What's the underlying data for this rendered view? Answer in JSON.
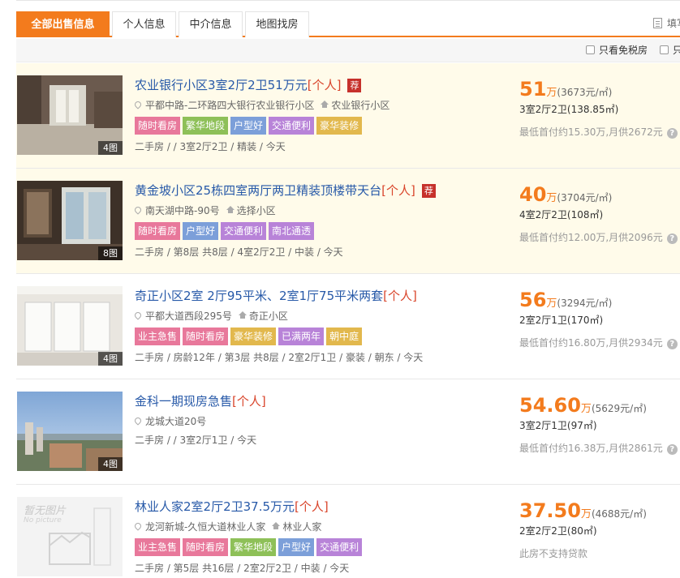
{
  "tabs": [
    {
      "label": "全部出售信息",
      "active": true
    },
    {
      "label": "个人信息",
      "active": false
    },
    {
      "label": "中介信息",
      "active": false
    },
    {
      "label": "地图找房",
      "active": false
    }
  ],
  "fill_form_label": "填写二",
  "filters": [
    "只看免税房",
    "只"
  ],
  "colors": {
    "accent": "#f37b1d",
    "link": "#2759a8",
    "personal": "#d9452b",
    "tag_pink": "#e8789b",
    "tag_green": "#8ec058",
    "tag_blue": "#7c9fd9",
    "tag_purple": "#b883d8",
    "tag_gold": "#e2b84d"
  },
  "listings": [
    {
      "title": "农业银行小区3室2厅2卫51万元",
      "personal": "[个人]",
      "recommended": "荐",
      "address": "平都中路-二环路四大银行农业银行小区",
      "community": "农业银行小区",
      "tags": [
        "随时看房",
        "繁华地段",
        "户型好",
        "交通便利",
        "豪华装修"
      ],
      "meta": "二手房 / / 3室2厅2卫 / 精装 / 今天",
      "price": "51",
      "price_unit": "万",
      "unit_price": "(3673元/㎡)",
      "layout": "3室2厅2卫(138.85㎡)",
      "loan": "最低首付约15.30万,月供2672元",
      "photo_count": "4图"
    },
    {
      "title": "黄金坡小区25栋四室两厅两卫精装顶楼带天台",
      "personal": "[个人]",
      "recommended": "荐",
      "address": "南天湖中路-90号",
      "community": "选择小区",
      "tags": [
        "随时看房",
        "户型好",
        "交通便利",
        "南北通透"
      ],
      "meta": "二手房 / 第8层 共8层 / 4室2厅2卫 / 中装 / 今天",
      "price": "40",
      "price_unit": "万",
      "unit_price": "(3704元/㎡)",
      "layout": "4室2厅2卫(108㎡)",
      "loan": "最低首付约12.00万,月供2096元",
      "photo_count": "8图"
    },
    {
      "title": "奇正小区2室 2厅95平米、2室1厅75平米两套",
      "personal": "[个人]",
      "recommended": "",
      "address": "平都大道西段295号",
      "community": "奇正小区",
      "tags": [
        "业主急售",
        "随时看房",
        "豪华装修",
        "已满两年",
        "朝中庭"
      ],
      "meta": "二手房 / 房龄12年 / 第3层 共8层 / 2室2厅1卫 / 豪装 / 朝东 / 今天",
      "price": "56",
      "price_unit": "万",
      "unit_price": "(3294元/㎡)",
      "layout": "2室2厅1卫(170㎡)",
      "loan": "最低首付约16.80万,月供2934元",
      "photo_count": "4图"
    },
    {
      "title": "金科一期现房急售",
      "personal": "[个人]",
      "recommended": "",
      "address": "龙城大道20号",
      "community": "",
      "tags": [],
      "meta": "二手房 / / 3室2厅1卫 / 今天",
      "price": "54.60",
      "price_unit": "万",
      "unit_price": "(5629元/㎡)",
      "layout": "3室2厅1卫(97㎡)",
      "loan": "最低首付约16.38万,月供2861元",
      "photo_count": "4图"
    },
    {
      "title": "林业人家2室2厅2卫37.5万元",
      "personal": "[个人]",
      "recommended": "",
      "address": "龙河新城-久恒大道林业人家",
      "community": "林业人家",
      "tags": [
        "业主急售",
        "随时看房",
        "繁华地段",
        "户型好",
        "交通便利"
      ],
      "meta": "二手房 / 第5层 共16层 / 2室2厅2卫 / 中装 / 今天",
      "price": "37.50",
      "price_unit": "万",
      "unit_price": "(4688元/㎡)",
      "layout": "2室2厅2卫(80㎡)",
      "loan": "此房不支持贷款",
      "photo_count": "",
      "no_picture": {
        "cn": "暂无图片",
        "en": "No picture"
      }
    }
  ]
}
